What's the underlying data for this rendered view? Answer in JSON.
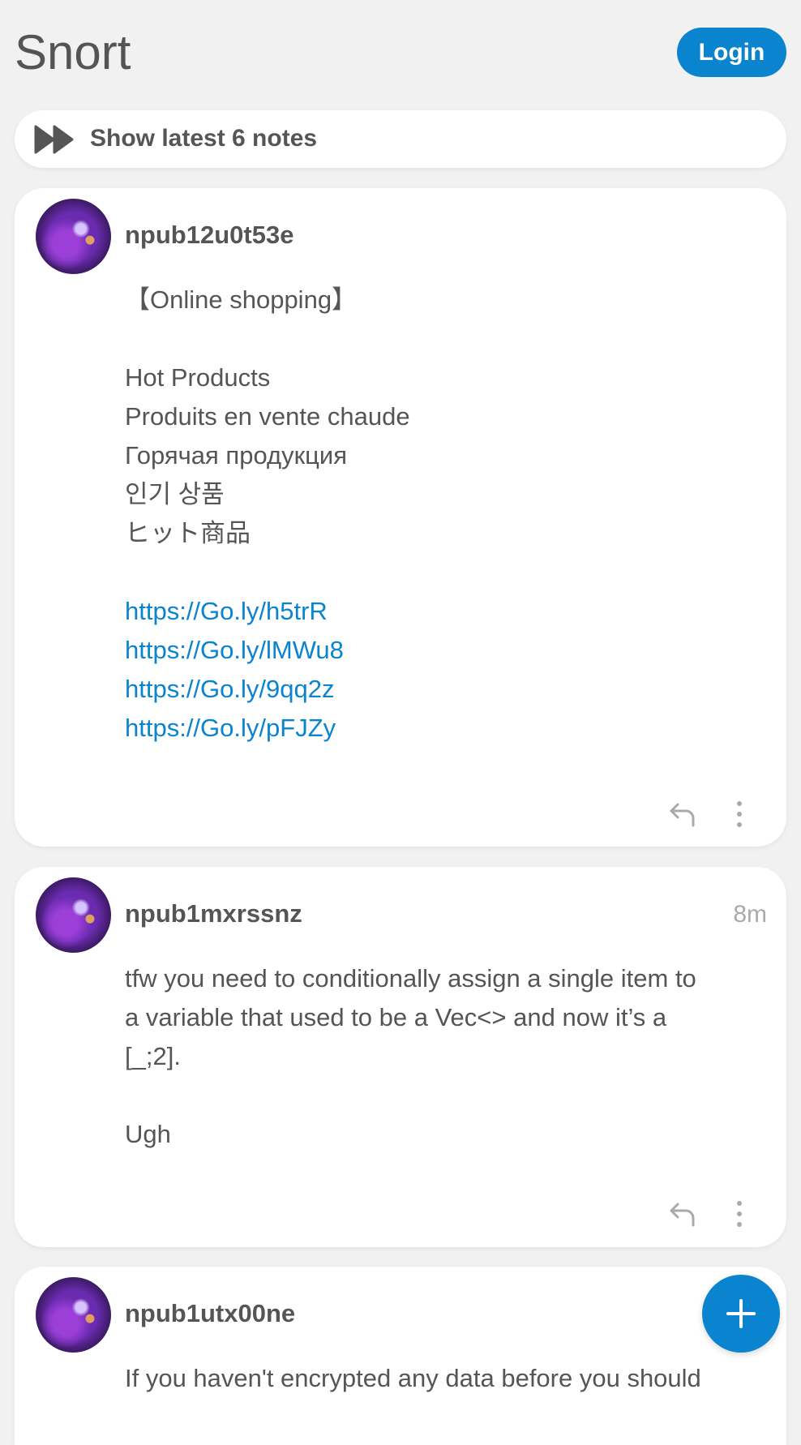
{
  "app": {
    "title": "Snort",
    "login_label": "Login"
  },
  "latest": {
    "label": "Show latest 6 notes",
    "icon": "fast-forward-icon"
  },
  "notes": [
    {
      "author": "npub12u0t53e",
      "time": "",
      "lines": [
        "【Online shopping】",
        "",
        "Hot Products",
        "Produits en vente chaude",
        " Горячая продукция",
        "인기 상품",
        "ヒット商品",
        ""
      ],
      "links": [
        "https://Go.ly/h5trR",
        "https://Go.ly/lMWu8",
        "https://Go.ly/9qq2z",
        "https://Go.ly/pFJZy"
      ]
    },
    {
      "author": "npub1mxrssnz",
      "time": "8m",
      "lines": [
        "tfw you need to conditionally assign a single item to",
        "a variable that used to be a Vec<> and now it’s a",
        "[_;2].",
        "",
        "Ugh"
      ]
    },
    {
      "author": "npub1utx00ne",
      "time": "",
      "lines": [
        "If you haven't encrypted any data before you should"
      ]
    }
  ],
  "colors": {
    "accent": "#0a84cf",
    "background": "#f1f1f2",
    "card": "#ffffff",
    "text": "#555555"
  }
}
